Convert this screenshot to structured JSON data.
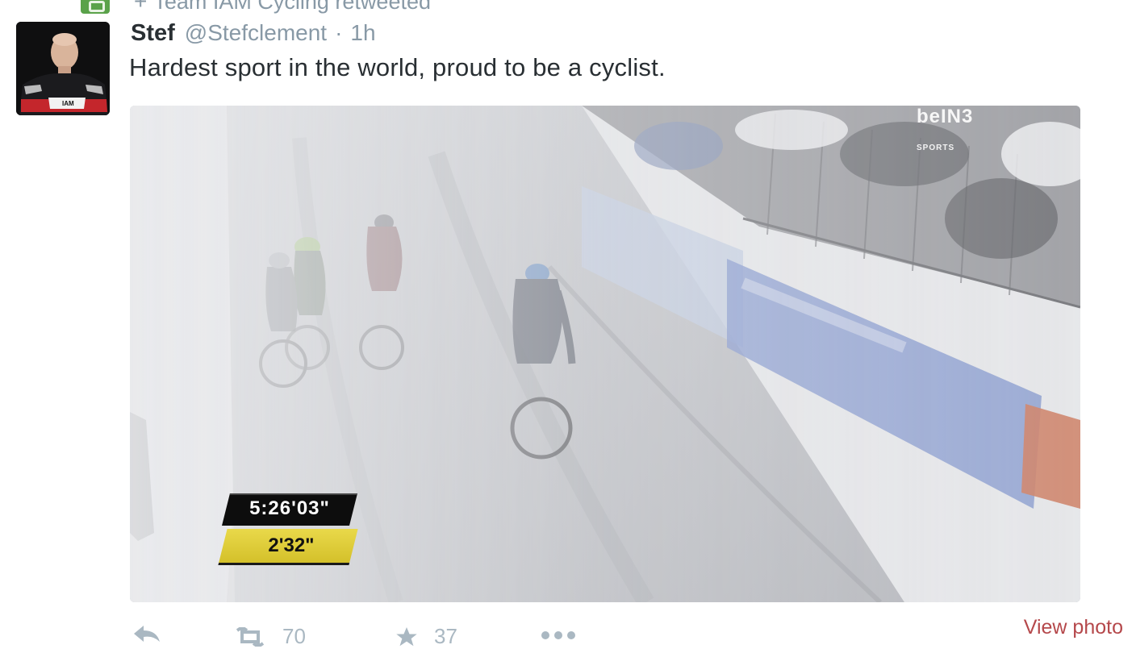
{
  "retweet": {
    "icon": "retweet-badge-icon",
    "plus": "+",
    "text": "Team IAM Cycling retweeted"
  },
  "tweet": {
    "name": "Stef",
    "handle": "@Stefclement",
    "separator": "·",
    "time": "1h",
    "text": "Hardest sport in the world, proud to be a cyclist."
  },
  "media": {
    "overlay_time": "5:26'03\"",
    "overlay_gap": "2'32\"",
    "broadcaster": "beIN",
    "broadcaster_num": "3",
    "broadcaster_sub": "SPORTS"
  },
  "actions": {
    "retweet_count": "70",
    "favorite_count": "37",
    "view_photo": "View photo"
  },
  "colors": {
    "link": "#b5484b",
    "muted": "#8899a6",
    "retweet_green": "#5aa24a"
  }
}
